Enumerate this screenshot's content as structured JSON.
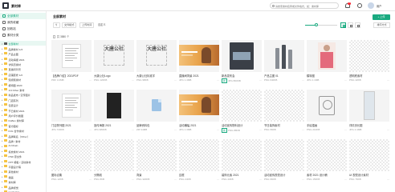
{
  "app": {
    "title": "素材库"
  },
  "header": {
    "search_placeholder": "请搜索素材名称或文件格式，如：素材库",
    "notification_count": "9",
    "user_name": "用户"
  },
  "nav": {
    "items": [
      {
        "label": "全部素材",
        "active": true
      },
      {
        "label": "我的收藏",
        "active": false
      },
      {
        "label": "回收站",
        "active": false
      },
      {
        "label": "素材分类",
        "active": false
      }
    ]
  },
  "tree": {
    "items": [
      {
        "label": "全部素材",
        "caret": "▾",
        "dark": true,
        "selected": true
      },
      {
        "label": "品牌素材 1/3",
        "caret": "▸",
        "dark": false
      },
      {
        "label": "产品主图",
        "caret": "▸",
        "dark": false
      },
      {
        "label": "活动海报 2021",
        "caret": "▸",
        "dark": false
      },
      {
        "label": "详情页素材",
        "caret": "▸",
        "dark": false
      },
      {
        "label": "直播间背景",
        "caret": "▸",
        "dark": false
      },
      {
        "label": "店铺装修 1/2",
        "caret": "▸",
        "dark": false
      },
      {
        "label": "短视频素材",
        "caret": "▸",
        "dark": false
      },
      {
        "label": "模特图 2020",
        "caret": "▸",
        "dark": false
      },
      {
        "label": "1/4 Other 素材",
        "caret": "▸",
        "dark": false
      },
      {
        "label": "新品发布 / 宣传图片",
        "caret": "▸",
        "dark": false
      },
      {
        "label": "门店陈列",
        "caret": "▸",
        "dark": false
      },
      {
        "label": "包装设计",
        "caret": "▸",
        "dark": false
      },
      {
        "label": "节日素材 2021",
        "caret": "▸",
        "dark": false
      },
      {
        "label": "用户评价截图",
        "caret": "▸",
        "dark": false
      },
      {
        "label": "DoBox 素材库",
        "caret": "▸",
        "dark": false
      },
      {
        "label": "官方图标",
        "caret": "▸",
        "dark": false
      },
      {
        "label": "KOL 合作素材",
        "caret": "▸",
        "dark": false
      },
      {
        "label": "品牌联名（Other）",
        "caret": "▸",
        "dark": false
      },
      {
        "label": "品牌 / 素材",
        "caret": "▸",
        "dark": false
      },
      {
        "label": "AI Chain",
        "caret": "▸",
        "dark": false
      },
      {
        "label": "投放素材 2021",
        "caret": "▸",
        "dark": false
      },
      {
        "label": "PSD 源文件",
        "caret": "▸",
        "dark": false
      },
      {
        "label": "PPT 模板 / 活动素材",
        "caret": "▸",
        "dark": false
      },
      {
        "label": "平面设计稿",
        "caret": "▸",
        "dark": false
      },
      {
        "label": "其他素材",
        "caret": "▸",
        "dark": false
      },
      {
        "label": "插画",
        "caret": "▸",
        "dark": false
      },
      {
        "label": "素材库",
        "caret": "▸",
        "dark": false
      },
      {
        "label": "品牌视觉",
        "caret": "▸",
        "dark": false
      },
      {
        "label": "marketing",
        "caret": "▸",
        "dark": false
      }
    ]
  },
  "toolbar": {
    "page_title": "全部素材",
    "filters": [
      "文件格式",
      "上传时间"
    ],
    "filter_tag": "自定义",
    "upload_label": "+ 上传",
    "sort_label": "排序方式",
    "select_all": "共 3580 个",
    "zoom_level": 0.35
  },
  "cards": [
    {
      "thumb": "doc",
      "name": "【品牌介绍】2021PDF",
      "meta": "PDF  3.2MB",
      "tag": ""
    },
    {
      "thumb": "stamp",
      "stamp_text": "大唐公社",
      "name": "大唐公社Logo",
      "meta": "PNG  120KB",
      "tag": ""
    },
    {
      "thumb": "stamp",
      "stamp_text": "大唐公社",
      "name": "大唐公社标准字",
      "meta": "PNG  98KB",
      "tag": ""
    },
    {
      "thumb": "banner",
      "name": "直播间背景 2021",
      "meta": "JPG  1.4MB",
      "tag": ""
    },
    {
      "thumb": "phone",
      "name": "新品发布会",
      "meta": "JPG  860KB",
      "tag": "新"
    },
    {
      "thumb": "bottles",
      "name": "产品主图 01",
      "meta": "PNG  640KB",
      "tag": ""
    },
    {
      "thumb": "model",
      "name": "模特图",
      "meta": "JPG  1.1MB",
      "tag": ""
    },
    {
      "thumb": "checker",
      "name": "透明底素材",
      "meta": "PNG  42KB",
      "tag": ""
    },
    {
      "thumb": "doc",
      "name": "门店陈列图 2021",
      "meta": "JPG  720KB",
      "tag": ""
    },
    {
      "thumb": "dark",
      "name": "宣传海报 2021",
      "meta": "JPG  980KB",
      "tag": ""
    },
    {
      "thumb": "file",
      "name": "品牌资料包",
      "meta": "ZIP  24MB",
      "tag": ""
    },
    {
      "thumb": "banner",
      "name": "活动横幅 2021",
      "meta": "JPG  1.3MB",
      "tag": ""
    },
    {
      "thumb": "checker",
      "name": "活动宣传物料设计",
      "meta": "PNG  88KB",
      "tag": "新"
    },
    {
      "thumb": "checker",
      "name": "节日装饰素材",
      "meta": "PNG  56KB",
      "tag": ""
    },
    {
      "thumb": "sketch",
      "name": "手绘插画",
      "meta": "PNG  210KB",
      "tag": ""
    },
    {
      "thumb": "tall",
      "name": "详情页长图",
      "meta": "JPG  2.4MB",
      "tag": ""
    },
    {
      "thumb": "checker",
      "name": "图标合集",
      "meta": "PNG  12KB",
      "tag": ""
    },
    {
      "thumb": "checker",
      "name": "分隔线",
      "meta": "PNG  8KB",
      "tag": ""
    },
    {
      "thumb": "checker",
      "name": "背景",
      "meta": "PNG  320KB",
      "tag": ""
    },
    {
      "thumb": "checker",
      "name": "边框",
      "meta": "PNG  24KB",
      "tag": ""
    },
    {
      "thumb": "checker",
      "name": "装饰元素 2021",
      "meta": "PNG  44KB",
      "tag": ""
    },
    {
      "thumb": "checker",
      "name": "活动宣传视觉设计",
      "meta": "PNG  96KB",
      "tag": ""
    },
    {
      "thumb": "checker",
      "name": "素材 2021 设计稿",
      "meta": "PNG  150KB",
      "tag": ""
    },
    {
      "thumb": "checker",
      "name": "UI 视觉设计素材",
      "meta": "PNG  76KB",
      "tag": ""
    }
  ],
  "colors": {
    "accent": "#1aaa80",
    "badge": "#f5222d"
  }
}
